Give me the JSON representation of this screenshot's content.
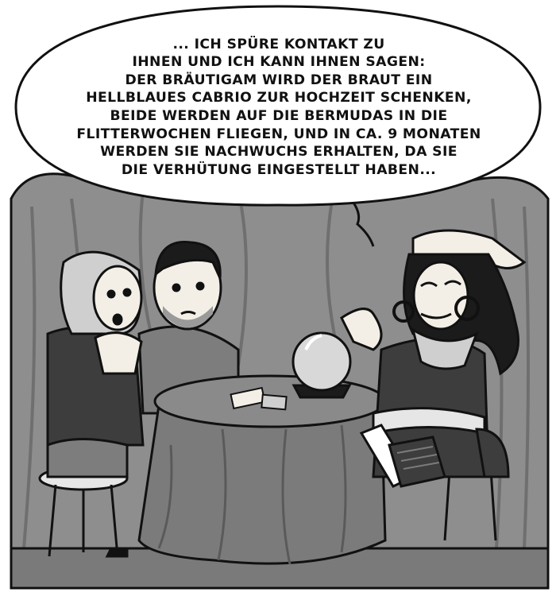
{
  "speech_bubble": {
    "lines": [
      "... ICH SPÜRE KONTAKT ZU",
      "IHNEN UND ICH KANN IHNEN SAGEN:",
      "DER BRÄUTIGAM WIRD DER BRAUT EIN",
      "HELLBLAUES CABRIO ZUR HOCHZEIT SCHENKEN,",
      "BEIDE WERDEN AUF DIE BERMUDAS IN DIE",
      "FLITTERWOCHEN FLIEGEN, UND IN CA. 9 MONATEN",
      "WERDEN SIE NACHWUCHS ERHALTEN, DA SIE",
      "DIE VERHÜTUNG EINGESTELLT HABEN..."
    ]
  },
  "colors": {
    "curtain": "#8e8e8e",
    "curtain_shadow": "#6f6f6f",
    "outline": "#111111",
    "skin": "#f4efe6",
    "table_cloth": "#7b7b7b",
    "dark_cloth": "#3d3d3d",
    "laptop_glow": "#ffffff"
  }
}
